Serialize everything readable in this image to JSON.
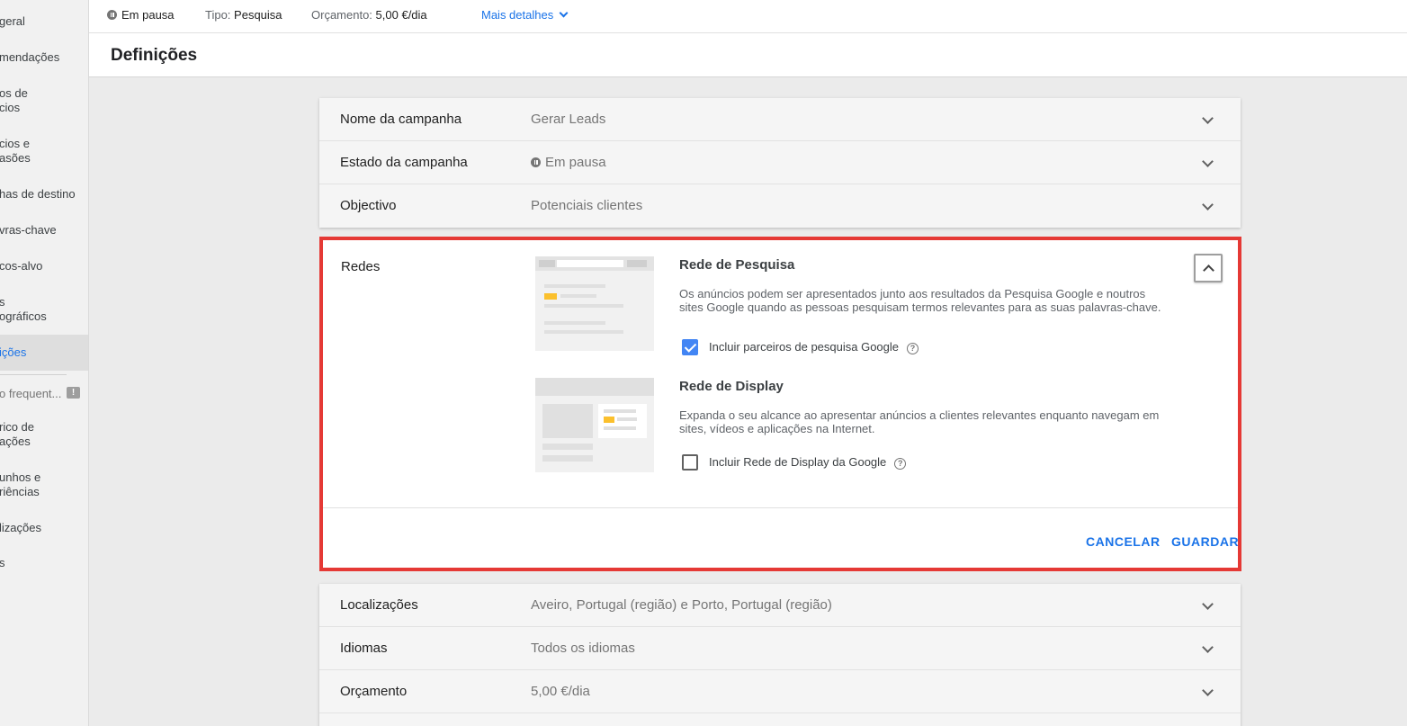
{
  "sidebar": {
    "items": [
      {
        "label": "Visão geral",
        "shown": "geral"
      },
      {
        "label": "Recomendações",
        "shown": "mendações"
      },
      {
        "label": "Grupos de anúncios",
        "shown": [
          "os de",
          "cios"
        ]
      },
      {
        "label": "Anúncios e extensões",
        "shown": [
          "cios e",
          "asões"
        ]
      },
      {
        "label": "Páginas de destino",
        "shown": "has de destino"
      },
      {
        "label": "Palavras-chave",
        "shown": "vras-chave"
      },
      {
        "label": "Públicos-alvo",
        "shown": "cos-alvo"
      },
      {
        "label": "Dados demográficos",
        "shown": [
          "s",
          "ográficos"
        ]
      },
      {
        "label": "Definições",
        "shown": "ições"
      },
      {
        "label": "Uso frequente",
        "shown": "o frequent..."
      },
      {
        "label": "Histórico de alterações",
        "shown": [
          "rico de",
          "ações"
        ]
      },
      {
        "label": "Rascunhos e experiências",
        "shown": [
          "unhos e",
          "riências"
        ]
      },
      {
        "label": "Localizações",
        "shown": "lizações"
      },
      {
        "label": "...",
        "shown": "s"
      }
    ]
  },
  "topbar": {
    "status": "Em pausa",
    "type_label": "Tipo:",
    "type_value": "Pesquisa",
    "budget_label": "Orçamento:",
    "budget_value": "5,00 €/dia",
    "more_details": "Mais detalhes"
  },
  "page": {
    "title": "Definições"
  },
  "settings_top": [
    {
      "label": "Nome da campanha",
      "value": "Gerar Leads"
    },
    {
      "label": "Estado da campanha",
      "value": "Em pausa"
    },
    {
      "label": "Objectivo",
      "value": "Potenciais clientes"
    }
  ],
  "networks": {
    "label": "Redes",
    "search": {
      "title": "Rede de Pesquisa",
      "description": "Os anúncios podem ser apresentados junto aos resultados da Pesquisa Google e noutros sites Google quando as pessoas pesquisam termos relevantes para as suas palavras-chave.",
      "checkbox_label": "Incluir parceiros de pesquisa Google",
      "checked": true
    },
    "display": {
      "title": "Rede de Display",
      "description": "Expanda o seu alcance ao apresentar anúncios a clientes relevantes enquanto navegam em sites, vídeos e aplicações na Internet.",
      "checkbox_label": "Incluir Rede de Display da Google",
      "checked": false
    },
    "cancel": "CANCELAR",
    "save": "GUARDAR"
  },
  "settings_bottom": [
    {
      "label": "Localizações",
      "value": "Aveiro, Portugal (região) e Porto, Portugal (região)"
    },
    {
      "label": "Idiomas",
      "value": "Todos os idiomas"
    },
    {
      "label": "Orçamento",
      "value": "5,00 €/dia"
    }
  ],
  "colors": {
    "accent": "#1a73e8",
    "highlight_border": "#e53935",
    "checkbox": "#4285f4",
    "illustration_yellow": "#fbc02d"
  }
}
